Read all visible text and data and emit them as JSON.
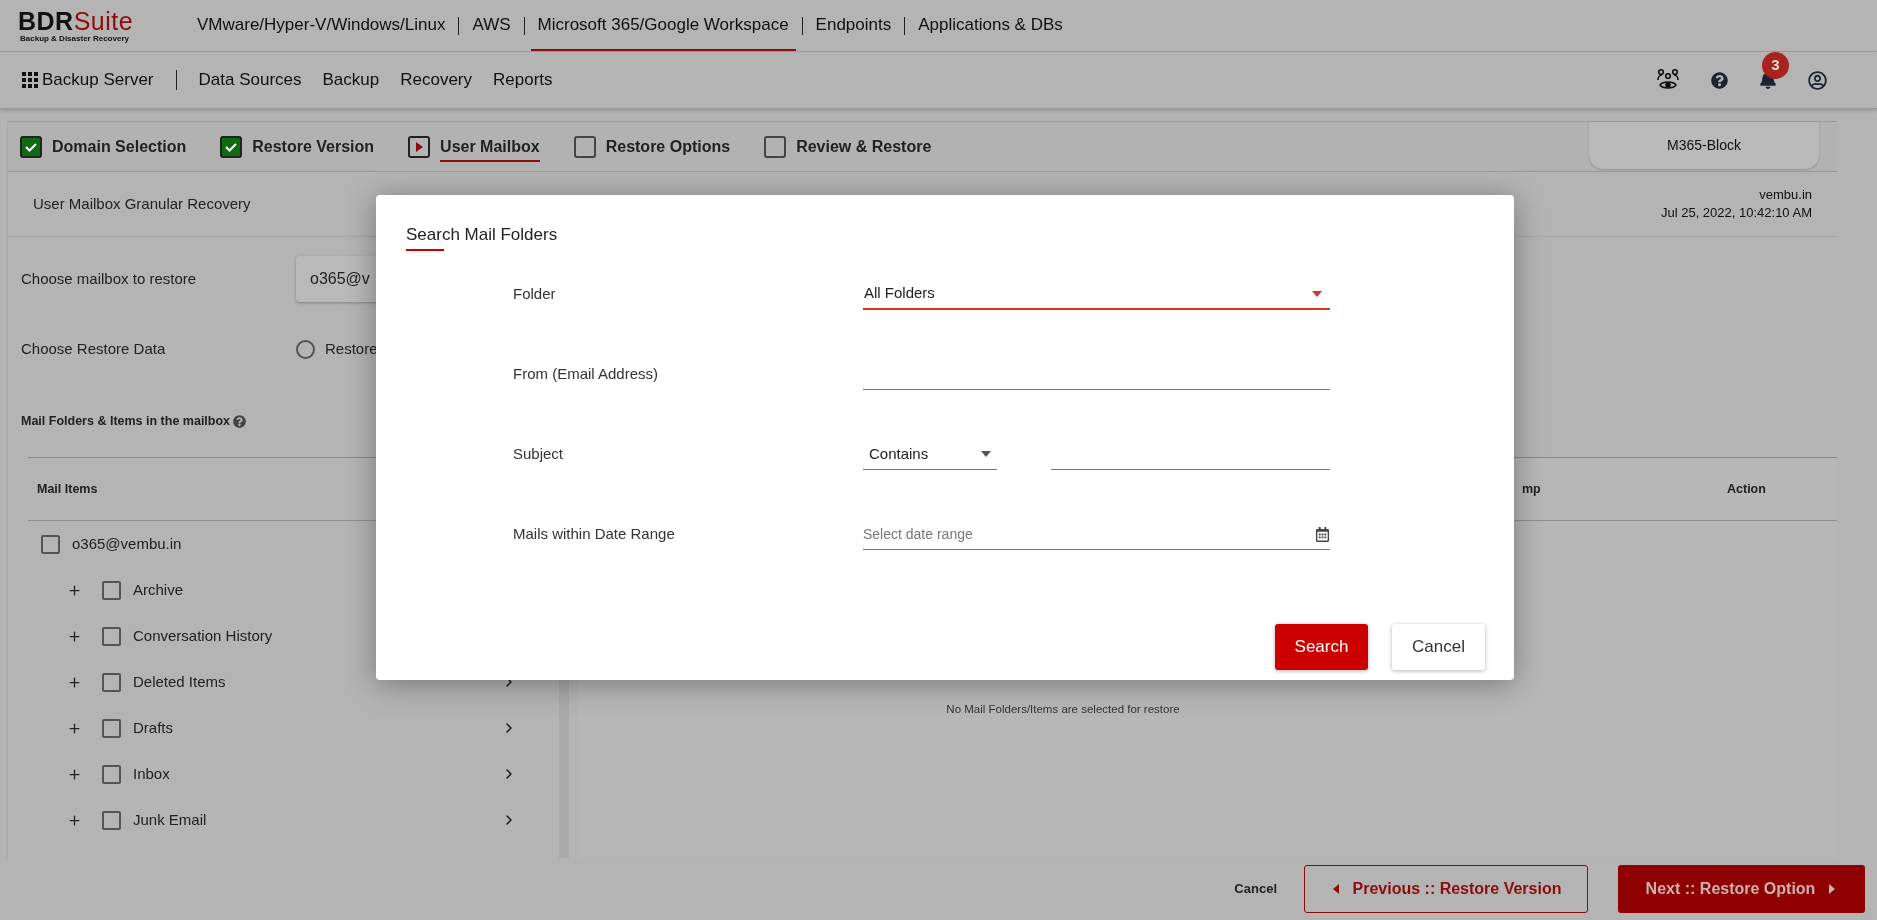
{
  "top_nav": {
    "logo_prefix": "BDR",
    "logo_suffix": "Suite",
    "tagline": "Backup & Disaster Recovery",
    "items": [
      {
        "label": "VMware/Hyper-V/Windows/Linux",
        "selected": false
      },
      {
        "label": "AWS",
        "selected": false
      },
      {
        "label": "Microsoft 365/Google Workspace",
        "selected": true
      },
      {
        "label": "Endpoints",
        "selected": false
      },
      {
        "label": "Applications & DBs",
        "selected": false
      }
    ]
  },
  "main_nav": {
    "home": "Backup Server",
    "items": [
      "Data Sources",
      "Backup",
      "Recovery",
      "Reports"
    ],
    "notification_count": "3"
  },
  "steps": [
    {
      "label": "Domain Selection",
      "completed": true,
      "current": false
    },
    {
      "label": "Restore Version",
      "completed": true,
      "current": false
    },
    {
      "label": "User Mailbox",
      "completed": false,
      "current": true
    },
    {
      "label": "Restore Options",
      "completed": false,
      "current": false
    },
    {
      "label": "Review & Restore",
      "completed": false,
      "current": false
    }
  ],
  "plan_tab": "M365-Block",
  "page_header": {
    "title": "User Mailbox Granular Recovery",
    "domain": "vembu.in",
    "timestamp": "Jul 25, 2022, 10:42:10 AM"
  },
  "form": {
    "mailbox_label": "Choose mailbox to restore",
    "mailbox_value": "o365@v",
    "restore_data_label": "Choose Restore Data",
    "restore_option": {
      "label": "Restore",
      "selected": false
    }
  },
  "mail_section": {
    "title": "Mail Folders & Items in the mailbox",
    "column": "Mail Items",
    "root": {
      "label": "o365@vembu.in",
      "checked": false,
      "children": [
        {
          "label": "Archive",
          "checked": false,
          "expanded": false,
          "chevron": false
        },
        {
          "label": "Conversation History",
          "checked": false,
          "expanded": false,
          "chevron": false
        },
        {
          "label": "Deleted Items",
          "checked": false,
          "expanded": false,
          "chevron": true
        },
        {
          "label": "Drafts",
          "checked": false,
          "expanded": false,
          "chevron": true
        },
        {
          "label": "Inbox",
          "checked": false,
          "expanded": false,
          "chevron": true
        },
        {
          "label": "Junk Email",
          "checked": false,
          "expanded": false,
          "chevron": true
        }
      ]
    }
  },
  "selected_table": {
    "columns": [
      "mp",
      "Action"
    ],
    "empty_message": "No Mail Folders/Items are selected for restore"
  },
  "footer": {
    "cancel": "Cancel",
    "previous": "Previous :: Restore Version",
    "next": "Next :: Restore Option"
  },
  "dialog": {
    "title": "Search Mail Folders",
    "fields": [
      {
        "kind": "select",
        "label": "Folder",
        "value": "All Folders"
      },
      {
        "kind": "text",
        "label": "From (Email Address)"
      },
      {
        "kind": "operator_text",
        "label": "Subject",
        "operator": "Contains"
      },
      {
        "kind": "date",
        "label": "Mails within Date Range",
        "placeholder": "Select date range"
      }
    ],
    "buttons": [
      {
        "label": "Search",
        "kind": "primary"
      },
      {
        "label": "Cancel",
        "kind": "secondary"
      }
    ]
  }
}
